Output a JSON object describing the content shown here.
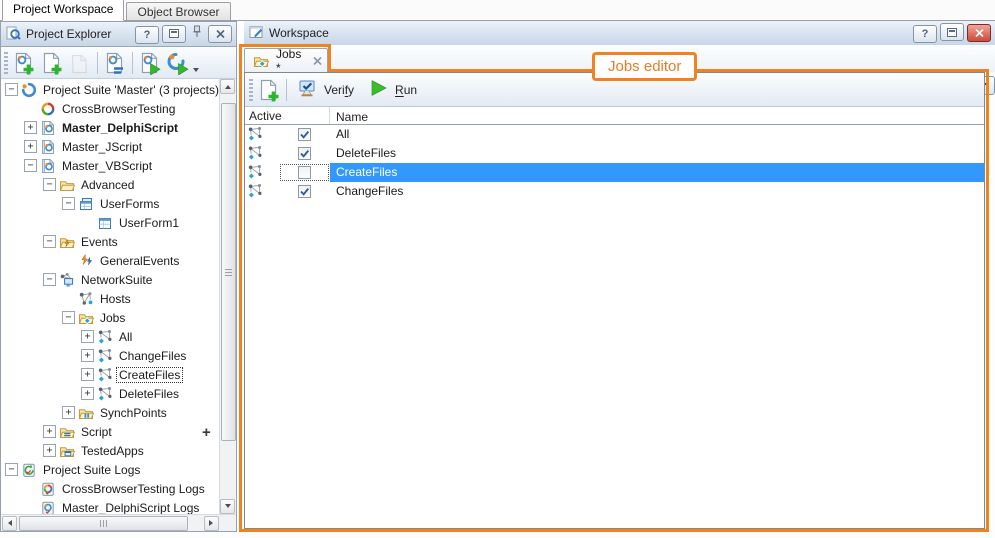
{
  "window": {
    "tabs": [
      {
        "label": "Project Workspace",
        "active": true
      },
      {
        "label": "Object Browser",
        "active": false
      }
    ]
  },
  "colors": {
    "annotation": "#f0831e",
    "selection": "#3398fe",
    "run_green": "#35b82c"
  },
  "project_explorer": {
    "title": "Project Explorer",
    "header_buttons": [
      {
        "name": "help-icon",
        "glyph": "?"
      },
      {
        "name": "restore-icon"
      },
      {
        "name": "pin-icon"
      },
      {
        "name": "close-icon"
      }
    ],
    "toolbar": {
      "items": [
        {
          "icon": "add-project-suite-icon"
        },
        {
          "icon": "add-item-icon"
        },
        {
          "icon": "open-icon",
          "disabled": true
        },
        {
          "sep": true
        },
        {
          "icon": "organize-items-icon"
        },
        {
          "sep": true
        },
        {
          "icon": "run-project-icon"
        },
        {
          "icon": "run-project-suite-icon"
        },
        {
          "icon": "toolbar-overflow-icon",
          "overflow": true
        }
      ]
    },
    "add_indicator": "+",
    "tree": {
      "items": [
        {
          "label": "Project Suite 'Master' (3 projects)",
          "level": 0,
          "expander": "minus",
          "icon": "project-suite"
        },
        {
          "label": "CrossBrowserTesting",
          "level": 1,
          "expander": "none",
          "icon": "cbt"
        },
        {
          "label": "Master_DelphiScript",
          "level": 1,
          "expander": "plus",
          "icon": "project",
          "bold": true
        },
        {
          "label": "Master_JScript",
          "level": 1,
          "expander": "plus",
          "icon": "project"
        },
        {
          "label": "Master_VBScript",
          "level": 1,
          "expander": "minus",
          "icon": "project"
        },
        {
          "label": "Advanced",
          "level": 2,
          "expander": "minus",
          "icon": "folder"
        },
        {
          "label": "UserForms",
          "level": 3,
          "expander": "minus",
          "icon": "userforms"
        },
        {
          "label": "UserForm1",
          "level": 4,
          "expander": "none",
          "icon": "userform"
        },
        {
          "label": "Events",
          "level": 2,
          "expander": "minus",
          "icon": "folder-events"
        },
        {
          "label": "GeneralEvents",
          "level": 3,
          "expander": "none",
          "icon": "events"
        },
        {
          "label": "NetworkSuite",
          "level": 2,
          "expander": "minus",
          "icon": "networksuite"
        },
        {
          "label": "Hosts",
          "level": 3,
          "expander": "none",
          "icon": "hosts"
        },
        {
          "label": "Jobs",
          "level": 3,
          "expander": "minus",
          "icon": "folder-jobs"
        },
        {
          "label": "All",
          "level": 4,
          "expander": "plus",
          "icon": "job"
        },
        {
          "label": "ChangeFiles",
          "level": 4,
          "expander": "plus",
          "icon": "job"
        },
        {
          "label": "CreateFiles",
          "level": 4,
          "expander": "plus",
          "icon": "job",
          "focused": true
        },
        {
          "label": "DeleteFiles",
          "level": 4,
          "expander": "plus",
          "icon": "job"
        },
        {
          "label": "SynchPoints",
          "level": 3,
          "expander": "plus",
          "icon": "folder-synch"
        },
        {
          "label": "Script",
          "level": 2,
          "expander": "plus",
          "icon": "folder-script"
        },
        {
          "label": "TestedApps",
          "level": 2,
          "expander": "plus",
          "icon": "folder-apps"
        },
        {
          "label": "Project Suite Logs",
          "level": 0,
          "expander": "minus",
          "icon": "logs-suite"
        },
        {
          "label": "CrossBrowserTesting Logs",
          "level": 1,
          "expander": "none",
          "icon": "logs-cbt"
        },
        {
          "label": "Master_DelphiScript Logs",
          "level": 1,
          "expander": "none",
          "icon": "logs-project"
        }
      ]
    }
  },
  "workspace": {
    "title": "Workspace",
    "header_buttons": [
      {
        "name": "help-icon",
        "glyph": "?"
      },
      {
        "name": "restore-icon"
      },
      {
        "name": "close-icon",
        "danger": true
      }
    ],
    "editor_tab": {
      "label": "Jobs *",
      "icon": "folder-jobs"
    },
    "callout": {
      "label": "Jobs editor"
    },
    "toolbar": {
      "items": [
        {
          "icon": "add-new-item-icon"
        },
        {
          "sep": true
        },
        {
          "icon": "verify-icon",
          "label": "Verify",
          "underline": 4
        },
        {
          "icon": "run-icon",
          "label": "Run",
          "underline": 0
        }
      ]
    },
    "table": {
      "columns": [
        "Active",
        "Name"
      ],
      "rows": [
        {
          "name": "All",
          "active": true,
          "selected": false
        },
        {
          "name": "DeleteFiles",
          "active": true,
          "selected": false
        },
        {
          "name": "CreateFiles",
          "active": false,
          "selected": true
        },
        {
          "name": "ChangeFiles",
          "active": true,
          "selected": false
        }
      ]
    }
  }
}
